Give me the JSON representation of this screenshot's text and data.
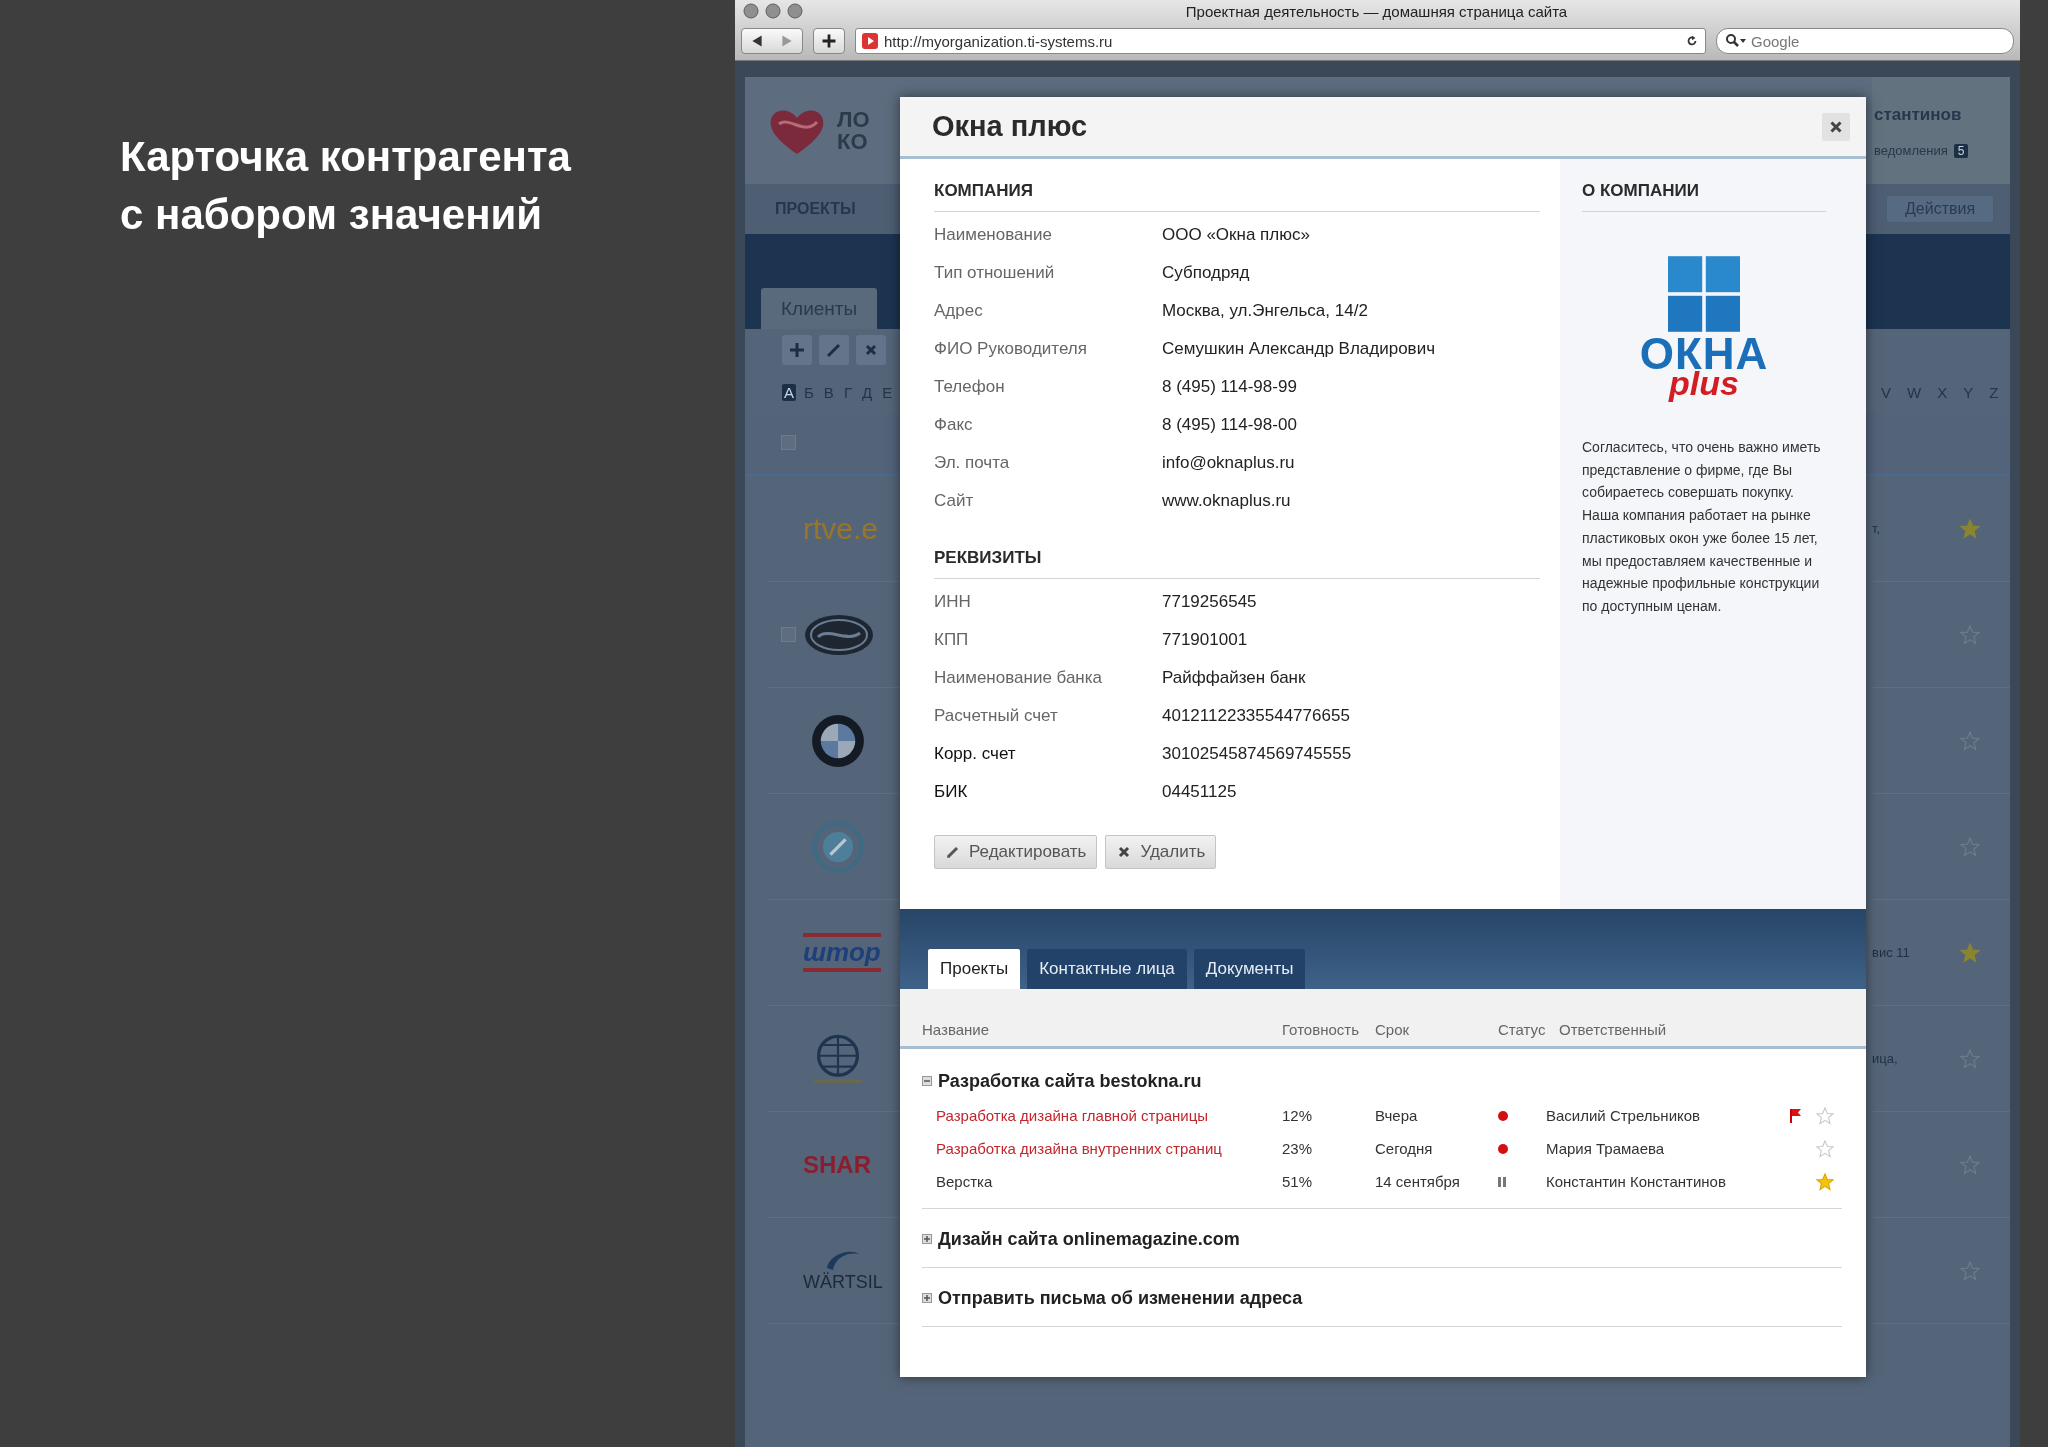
{
  "slide": {
    "heading_lines": [
      "Карточка контрагента",
      "с набором значений"
    ]
  },
  "browser": {
    "title": "Проектная деятельность — домашняя страница сайта",
    "url": "http://myorganization.ti-systems.ru",
    "search_placeholder": "Google"
  },
  "background_app": {
    "logo_lines": [
      "ЛО",
      "КО"
    ],
    "nav_item": "ПРОЕКТЫ",
    "user_name": "стантинов",
    "notifications_label": "ведомления",
    "notifications_count": "5",
    "actions_button": "Действия",
    "tab": "Клиенты",
    "alphabet_left": [
      {
        "letter": "А",
        "selected": true
      },
      {
        "letter": "Б",
        "selected": false
      },
      {
        "letter": "В",
        "selected": false
      },
      {
        "letter": "Г",
        "selected": false
      },
      {
        "letter": "Д",
        "selected": false
      },
      {
        "letter": "Е",
        "selected": false
      }
    ],
    "alphabet_right": [
      "V",
      "W",
      "X",
      "Y",
      "Z"
    ],
    "rows": [
      {
        "kind": "text",
        "logo_text": "rtve.e",
        "note": "т,",
        "starred": true
      },
      {
        "kind": "oval",
        "checkbox": {
          "checked": false
        },
        "starred": false
      },
      {
        "kind": "roundel",
        "starred": false
      },
      {
        "kind": "ring",
        "starred": false
      },
      {
        "kind": "banner",
        "logo_text": "штор",
        "note": "вис 11",
        "starred": true
      },
      {
        "kind": "globe",
        "note": "ица,",
        "starred": false
      },
      {
        "kind": "wordmark",
        "logo_text": "SHAR",
        "starred": false
      },
      {
        "kind": "swoosh",
        "logo_text": "WÄRTSIL",
        "starred": false
      }
    ],
    "select_all": {
      "checked": false
    }
  },
  "dialog": {
    "title": "Окна плюс",
    "sections": [
      {
        "heading": "КОМПАНИЯ",
        "fields": [
          {
            "label": "Наименование",
            "value": "ООО «Окна плюс»",
            "emphasized": false
          },
          {
            "label": "Тип отношений",
            "value": "Субподряд",
            "emphasized": false
          },
          {
            "label": "Адрес",
            "value": "Москва, ул.Энгельса, 14/2",
            "emphasized": false
          },
          {
            "label": "ФИО Руководителя",
            "value": "Семушкин Александр Владирович",
            "emphasized": false
          },
          {
            "label": "Телефон",
            "value": "8 (495) 114-98-99",
            "emphasized": false
          },
          {
            "label": "Факс",
            "value": "8 (495) 114-98-00",
            "emphasized": false
          },
          {
            "label": "Эл. почта",
            "value": "info@oknaplus.ru",
            "emphasized": false
          },
          {
            "label": "Сайт",
            "value": "www.oknaplus.ru",
            "emphasized": false
          }
        ]
      },
      {
        "heading": "РЕКВИЗИТЫ",
        "fields": [
          {
            "label": "ИНН",
            "value": "7719256545",
            "emphasized": false
          },
          {
            "label": "КПП",
            "value": "771901001",
            "emphasized": false
          },
          {
            "label": "Наименование банка",
            "value": "Райффайзен банк",
            "emphasized": false
          },
          {
            "label": "Расчетный счет",
            "value": "40121122335544776655",
            "emphasized": false
          },
          {
            "label": "Корр. счет",
            "value": "30102545874569745555",
            "emphasized": true
          },
          {
            "label": "БИК",
            "value": "04451125",
            "emphasized": true
          }
        ]
      }
    ],
    "buttons": [
      {
        "label": "Редактировать",
        "kind": "edit"
      },
      {
        "label": "Удалить",
        "kind": "delete"
      }
    ],
    "about": {
      "heading": "О КОМПАНИИ",
      "logo_text": "ОКНА",
      "logo_subtext": "plus",
      "description": "Согласитесь, что очень важно иметь представление о фирме, где Вы собираетесь совершать покупку. Наша компания работает на рынке пластиковых окон уже более 15 лет, мы предоставляем качественные и надежные профильные конструкции по доступным ценам."
    },
    "tabs": [
      {
        "label": "Проекты",
        "selected": true
      },
      {
        "label": "Контактные лица",
        "selected": false
      },
      {
        "label": "Документы",
        "selected": false
      }
    ],
    "table": {
      "columns": [
        "Название",
        "Готовность",
        "Срок",
        "Статус",
        "Ответственный"
      ],
      "groups": [
        {
          "title": "Разработка сайта bestokna.ru",
          "expanded": true,
          "tasks": [
            {
              "name": "Разработка дизайна главной страницы",
              "overdue": true,
              "progress": "12%",
              "due": "Вчера",
              "paused": false,
              "assignee": "Василий Стрельников",
              "flagged": true,
              "starred": false
            },
            {
              "name": "Разработка дизайна внутренних страниц",
              "overdue": true,
              "progress": "23%",
              "due": "Сегодня",
              "paused": false,
              "assignee": "Мария Трамаева",
              "flagged": false,
              "starred": false
            },
            {
              "name": "Верстка",
              "overdue": false,
              "progress": "51%",
              "due": "14 сентября",
              "paused": true,
              "assignee": "Константин Константинов",
              "flagged": false,
              "starred": true
            }
          ]
        },
        {
          "title": "Дизайн сайта onlinemagazine.com",
          "expanded": false
        },
        {
          "title": "Отправить письма об изменении адреса",
          "expanded": false
        }
      ]
    }
  }
}
